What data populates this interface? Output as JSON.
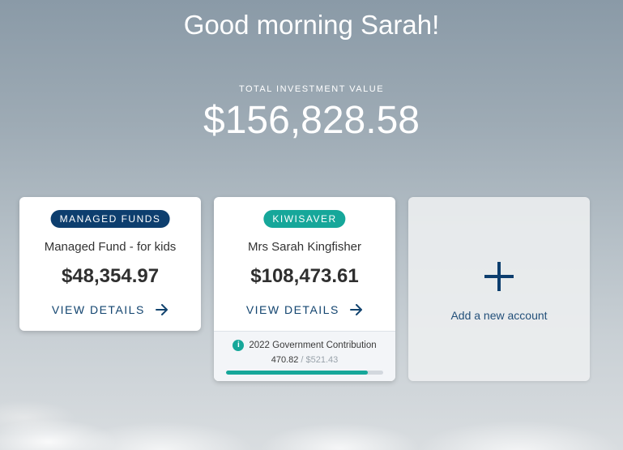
{
  "greeting": "Good morning Sarah!",
  "total": {
    "label": "TOTAL INVESTMENT VALUE",
    "value": "$156,828.58"
  },
  "accounts": [
    {
      "badge": "MANAGED FUNDS",
      "name": "Managed Fund - for kids",
      "value": "$48,354.97",
      "link_label": "VIEW DETAILS",
      "link_icon": "arrow-right-icon"
    },
    {
      "badge": "KIWISAVER",
      "name": "Mrs Sarah Kingfisher",
      "value": "$108,473.61",
      "link_label": "VIEW DETAILS",
      "link_icon": "arrow-right-icon",
      "contribution": {
        "title": "2022 Government Contribution",
        "icon": "info-icon",
        "current": "470.82",
        "separator": " / ",
        "target": "$521.43",
        "progress_fraction": 0.9
      }
    }
  ],
  "add_account": {
    "icon": "plus-icon",
    "label": "Add a new account"
  },
  "colors": {
    "navy": "#0d3e6e",
    "teal": "#16a79a",
    "link": "#12446f"
  }
}
